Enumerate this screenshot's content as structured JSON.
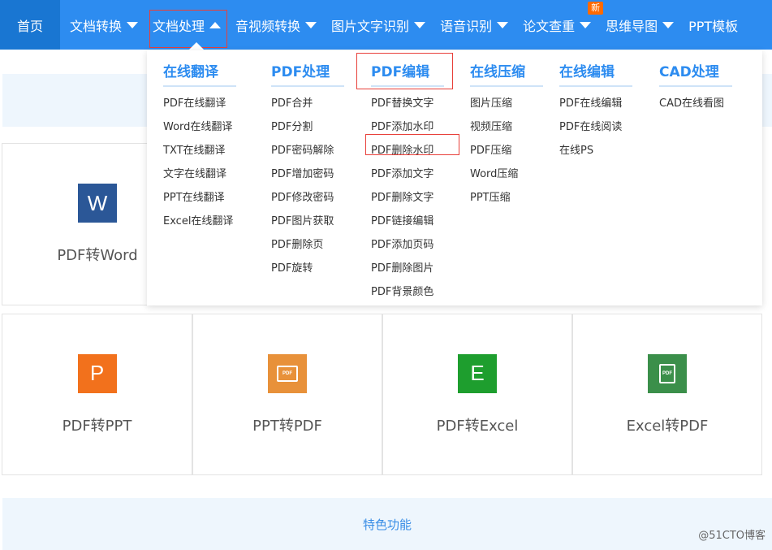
{
  "nav": {
    "items": [
      {
        "label": "首页"
      },
      {
        "label": "文档转换"
      },
      {
        "label": "文档处理"
      },
      {
        "label": "音视频转换"
      },
      {
        "label": "图片文字识别"
      },
      {
        "label": "语音识别"
      },
      {
        "label": "论文查重"
      },
      {
        "label": "思维导图"
      },
      {
        "label": "PPT模板"
      }
    ],
    "badge": "新"
  },
  "menu": {
    "columns": [
      {
        "title": "在线翻译",
        "items": [
          "PDF在线翻译",
          "Word在线翻译",
          "TXT在线翻译",
          "文字在线翻译",
          "PPT在线翻译",
          "Excel在线翻译"
        ]
      },
      {
        "title": "PDF处理",
        "items": [
          "PDF合并",
          "PDF分割",
          "PDF密码解除",
          "PDF增加密码",
          "PDF修改密码",
          "PDF图片获取",
          "PDF删除页",
          "PDF旋转"
        ]
      },
      {
        "title": "PDF编辑",
        "items": [
          "PDF替换文字",
          "PDF添加水印",
          "PDF删除水印",
          "PDF添加文字",
          "PDF删除文字",
          "PDF链接编辑",
          "PDF添加页码",
          "PDF删除图片",
          "PDF背景颜色"
        ]
      },
      {
        "title": "在线压缩",
        "items": [
          "图片压缩",
          "视频压缩",
          "PDF压缩",
          "Word压缩",
          "PPT压缩"
        ]
      },
      {
        "title": "在线编辑",
        "items": [
          "PDF在线编辑",
          "PDF在线阅读",
          "在线PS"
        ]
      },
      {
        "title": "CAD处理",
        "items": [
          "CAD在线看图"
        ]
      }
    ]
  },
  "cards": {
    "row1": [
      {
        "label": "PDF转Word",
        "icon": "word-icon",
        "glyph": "W"
      }
    ],
    "row2": [
      {
        "label": "PDF转PPT",
        "icon": "ppt-icon",
        "glyph": "P"
      },
      {
        "label": "PPT转PDF",
        "icon": "ppt-to-pdf-icon",
        "glyph": "PDF"
      },
      {
        "label": "PDF转Excel",
        "icon": "excel-icon",
        "glyph": "E"
      },
      {
        "label": "Excel转PDF",
        "icon": "excel-to-pdf-icon",
        "glyph": "PDF"
      }
    ]
  },
  "feature": {
    "title": "特色功能"
  },
  "watermark": "@51CTO博客",
  "colors": {
    "nav": "#2d8cf0",
    "nav_home": "#1976d2",
    "highlight": "#e8403a"
  }
}
